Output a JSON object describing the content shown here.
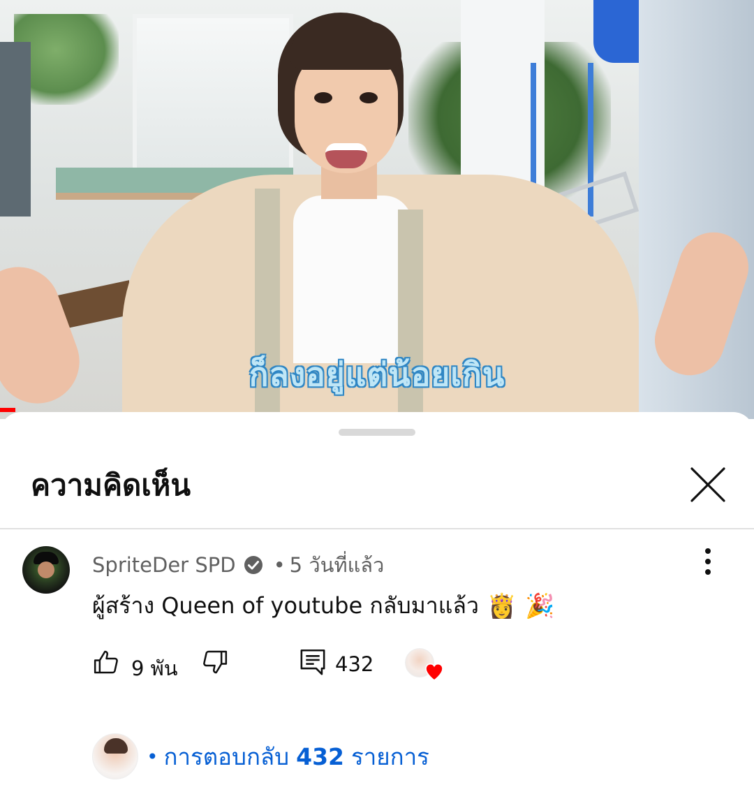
{
  "video": {
    "caption": "ก็ลงอยู่แต่น้อยเกิน",
    "progress_percent": 2
  },
  "sheet": {
    "title": "ความคิดเห็น"
  },
  "icons": {
    "close": "close-icon",
    "verified": "verified-check-icon",
    "more": "more-vert-icon",
    "like": "thumb-up-icon",
    "dislike": "thumb-down-icon",
    "reply": "reply-comment-icon",
    "creator_heart": "heart-icon"
  },
  "comment": {
    "author": "SpriteDer SPD",
    "separator": "•",
    "time": "5 วันที่แล้ว",
    "text": "ผู้สร้าง Queen of youtube กลับมาแล้ว",
    "emoji_1": "👸",
    "emoji_2": "🎉",
    "like_count": "9 พัน",
    "reply_count": "432"
  },
  "replies": {
    "bullet": "•",
    "prefix": "การตอบกลับ",
    "count": "432",
    "suffix": "รายการ"
  },
  "colors": {
    "link_blue": "#065fd4",
    "heart_red": "#ff0000",
    "meta_gray": "#606060",
    "caption_fill": "#bfe6f6",
    "caption_outline": "#2f86c4"
  }
}
